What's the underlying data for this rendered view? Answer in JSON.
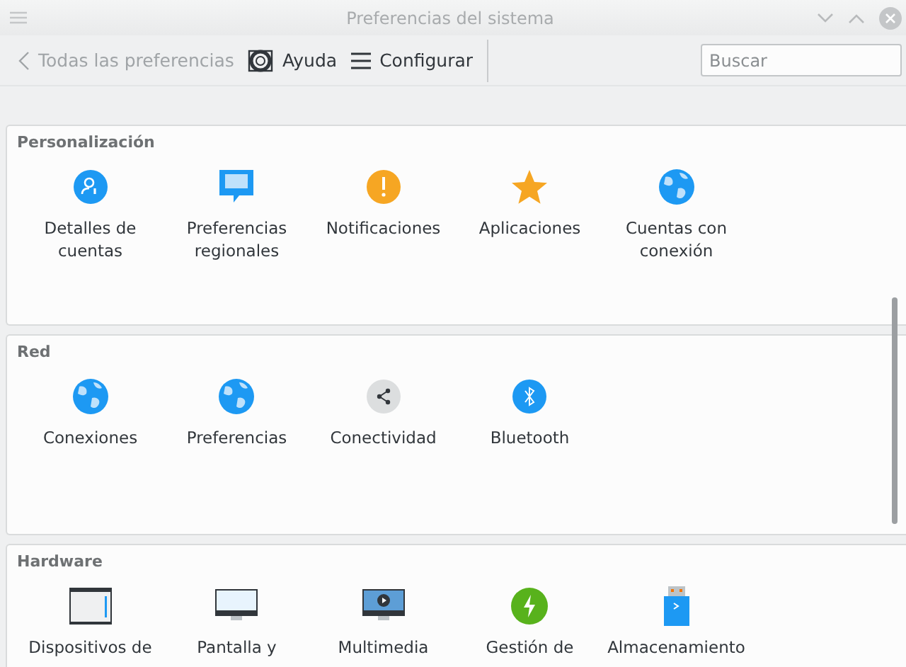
{
  "window": {
    "title": "Preferencias del sistema"
  },
  "toolbar": {
    "back": {
      "label": "Todas las preferencias",
      "disabled": true
    },
    "buttons": [
      {
        "label": "Ayuda",
        "kind": "help"
      },
      {
        "label": "Configurar",
        "kind": "menu"
      }
    ],
    "search": {
      "placeholder": "Buscar"
    }
  },
  "sections": [
    {
      "title": "Personalización",
      "items": [
        {
          "label": "Detalles de cuentas",
          "kind": "person"
        },
        {
          "label": "Preferencias regionales",
          "kind": "chat"
        },
        {
          "label": "Notificaciones",
          "kind": "alert"
        },
        {
          "label": "Aplicaciones",
          "kind": "star"
        },
        {
          "label": "Cuentas con conexión",
          "kind": "globe"
        }
      ]
    },
    {
      "title": "Red",
      "items": [
        {
          "label": "Conexiones",
          "kind": "globe"
        },
        {
          "label": "Preferencias",
          "kind": "globe"
        },
        {
          "label": "Conectividad",
          "kind": "share"
        },
        {
          "label": "Bluetooth",
          "kind": "bluetooth"
        }
      ]
    },
    {
      "title": "Hardware",
      "items": [
        {
          "label": "Dispositivos de",
          "kind": "panel"
        },
        {
          "label": "Pantalla y",
          "kind": "monitor"
        },
        {
          "label": "Multimedia",
          "kind": "media"
        },
        {
          "label": "Gestión de",
          "kind": "power"
        },
        {
          "label": "Almacenamiento",
          "kind": "usb"
        }
      ]
    }
  ]
}
